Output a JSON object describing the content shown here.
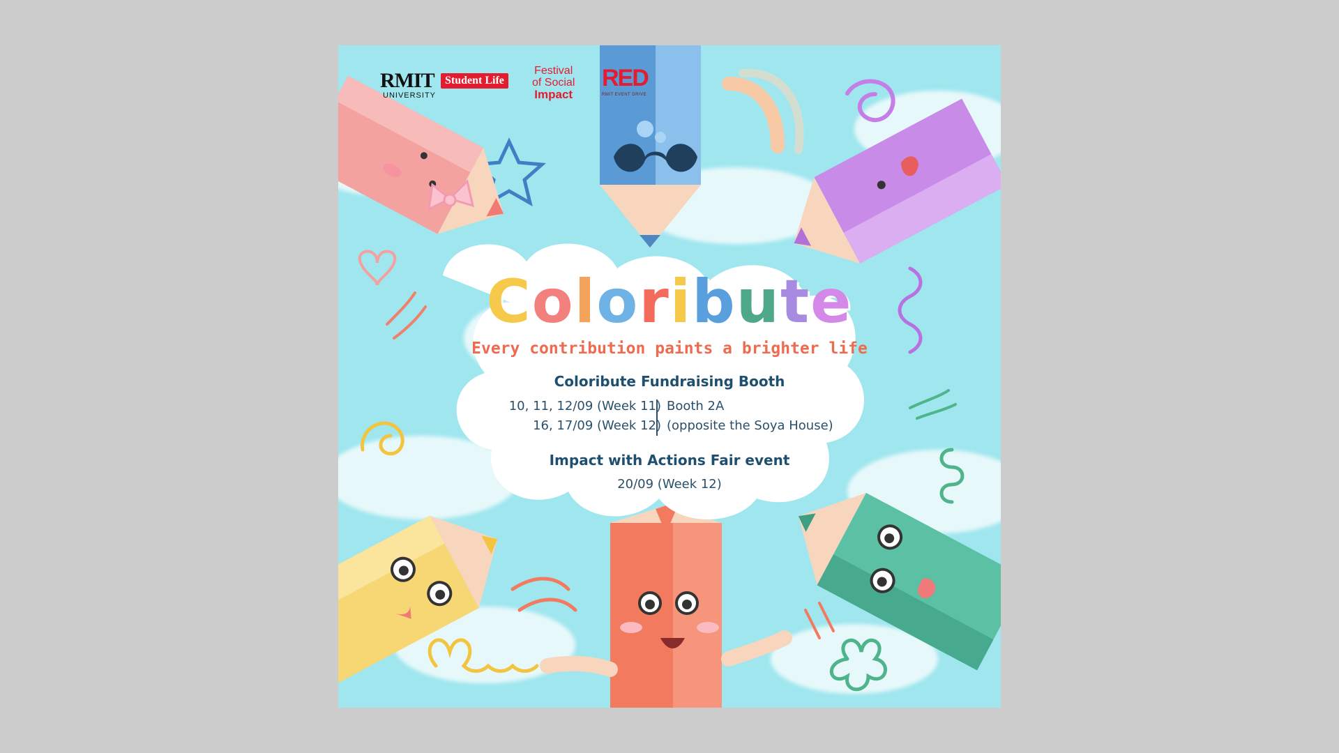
{
  "logos": {
    "rmit": "RMIT",
    "rmit_sub": "UNIVERSITY",
    "student_life": "Student Life",
    "fosi_line1": "Festival",
    "fosi_line2": "of Social",
    "fosi_line3": "Impact",
    "red": "RED",
    "red_sub": "RMIT EVENT DRIVE"
  },
  "headline": {
    "letters": [
      "C",
      "o",
      "l",
      "o",
      "r",
      "i",
      "b",
      "u",
      "t",
      "e"
    ],
    "colors": [
      "#f7c94a",
      "#f2807d",
      "#f3a35a",
      "#6fb2e6",
      "#f26b5b",
      "#f7c94a",
      "#5a9fdd",
      "#4fa88a",
      "#a78be0",
      "#d489e8"
    ]
  },
  "tagline": "Every contribution paints a brighter life",
  "booth": {
    "title": "Coloribute Fundraising Booth",
    "dates_line1": "10, 11, 12/09 (Week 11)",
    "dates_line2": "16, 17/09 (Week 12)",
    "location_line1": "Booth 2A",
    "location_line2": "(opposite the Soya House)"
  },
  "fair": {
    "title": "Impact with Actions Fair event",
    "date": "20/09 (Week 12)"
  },
  "colors": {
    "sky": "#9fe6ee",
    "pink_pencil": "#f3a2a0",
    "blue_pencil": "#5a9bd6",
    "purple_pencil": "#c88be8",
    "yellow_pencil": "#f7d774",
    "coral_pencil": "#f27a5e",
    "green_pencil": "#5cc0a4",
    "accent_red": "#e31c2f"
  }
}
